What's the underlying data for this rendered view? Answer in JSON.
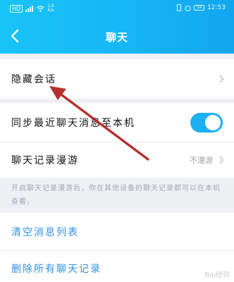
{
  "status_bar": {
    "carrier_badge": "HD",
    "speed": "1.9",
    "speed_unit": "K/s",
    "battery": "34",
    "time": "12:53"
  },
  "header": {
    "title": "聊天",
    "back_icon": "chevron-left-icon"
  },
  "rows": {
    "hidden_chats": {
      "label": "隐藏会话"
    },
    "sync_messages": {
      "label": "同步最近聊天消息至本机",
      "toggle_on": true
    },
    "chat_roaming": {
      "label": "聊天记录漫游",
      "value": "不漫游"
    }
  },
  "hint": "开启聊天记录漫游后，你在其他设备的聊天记录都可以在本机查看。",
  "actions": {
    "clear_message_list": "清空消息列表",
    "delete_all_history": "删除所有聊天记录"
  },
  "watermark": "Bai经验",
  "colors": {
    "header_start": "#19c4f6",
    "header_end": "#12a6f1",
    "toggle": "#1fb0f3",
    "action_text": "#2e8fe8",
    "annotation_arrow": "#b5302d"
  }
}
